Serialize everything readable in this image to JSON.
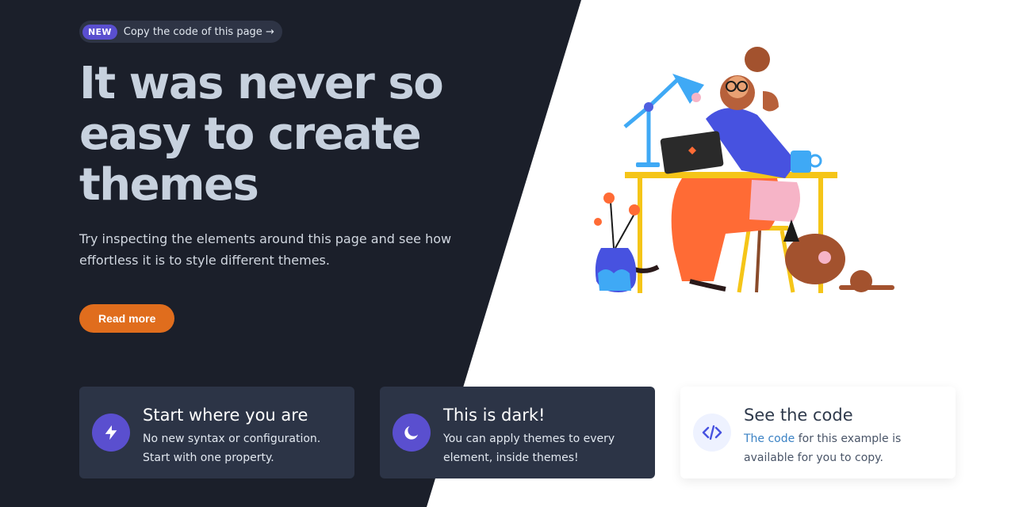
{
  "badge": {
    "tag": "NEW",
    "text": "Copy the code of this page →"
  },
  "hero": {
    "title": "It was never so easy to create themes",
    "subtitle": "Try inspecting the elements around this page and see how effortless it is to style different themes.",
    "button_label": "Read more"
  },
  "cards": [
    {
      "title": "Start where you are",
      "text": "No new syntax or configuration. Start with one property.",
      "icon": "bolt-icon"
    },
    {
      "title": "This is dark!",
      "text": "You can apply themes to every element, inside themes!",
      "icon": "moon-icon"
    },
    {
      "title": "See the code",
      "link_text": "The code",
      "text": " for this example is available for you to copy.",
      "icon": "code-icon"
    }
  ],
  "colors": {
    "dark_bg": "#1b1f2a",
    "card_dark": "#2c3446",
    "accent_purple": "#5a4fcf",
    "button_orange": "#e06d1d",
    "link_blue": "#3b82c4"
  }
}
